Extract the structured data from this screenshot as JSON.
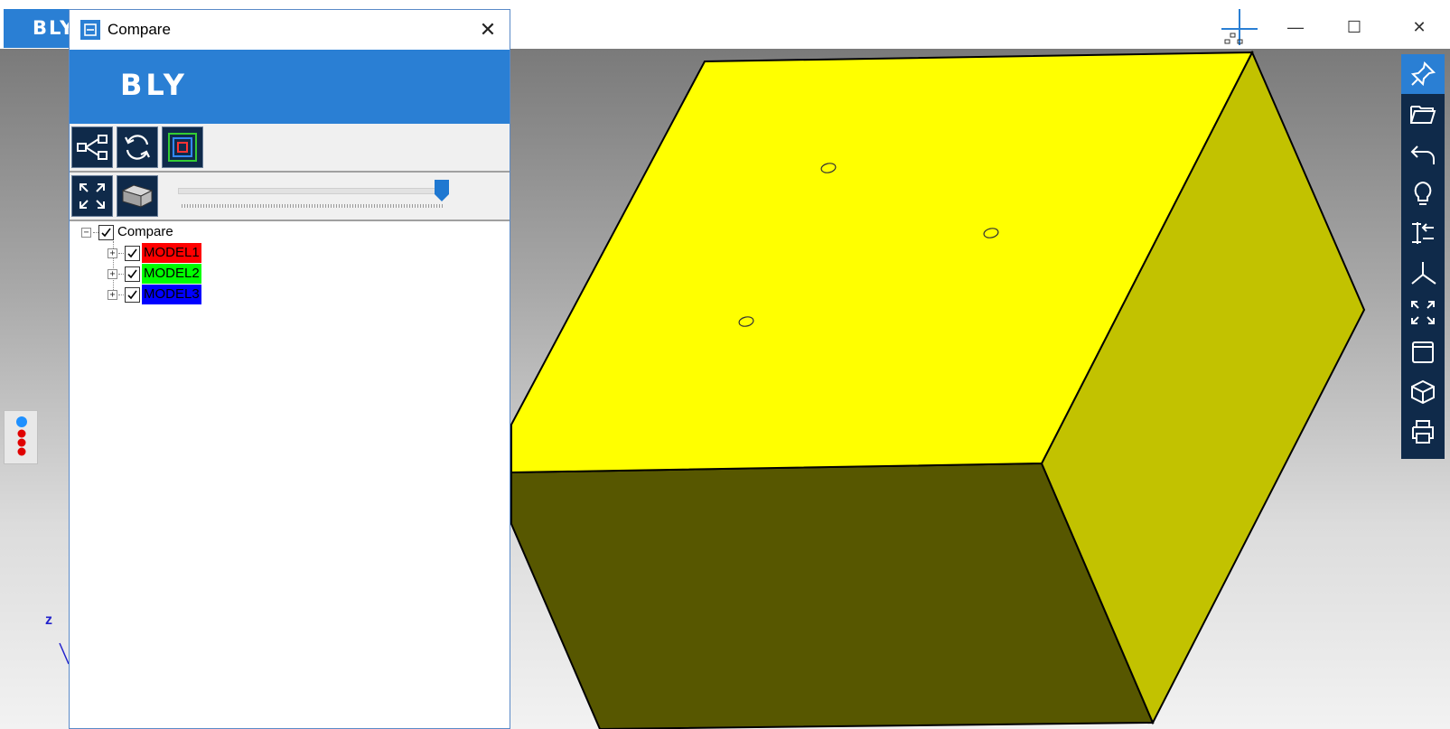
{
  "app": {
    "brand": "BLY",
    "window_controls": {
      "minimize": "—",
      "maximize": "☐",
      "close": "✕"
    }
  },
  "right_toolbar": {
    "icons": [
      "pin-icon",
      "folder-open-icon",
      "undo-icon",
      "lightbulb-icon",
      "align-icon",
      "axis-icon",
      "fit-view-icon",
      "window-view-icon",
      "shape-icon",
      "print-icon"
    ]
  },
  "compare_panel": {
    "title": "Compare",
    "close_glyph": "✕",
    "logo": "BLY",
    "toolbar1": [
      "hierarchy-icon",
      "refresh-icon",
      "layers-icon"
    ],
    "toolbar2": [
      "fit-icon",
      "box-view-icon"
    ],
    "transparency_slider": {
      "value": 1.0
    },
    "tree": {
      "root": {
        "label": "Compare",
        "checked": true
      },
      "children": [
        {
          "label": "MODEL1",
          "checked": true,
          "color": "#ff0000"
        },
        {
          "label": "MODEL2",
          "checked": true,
          "color": "#00ff00"
        },
        {
          "label": "MODEL3",
          "checked": true,
          "color": "#0000ff"
        }
      ]
    }
  },
  "viewport": {
    "axis_label": "z",
    "model_colors": {
      "top": "#ffff00",
      "side": "#c2c200",
      "front": "#575700"
    }
  }
}
